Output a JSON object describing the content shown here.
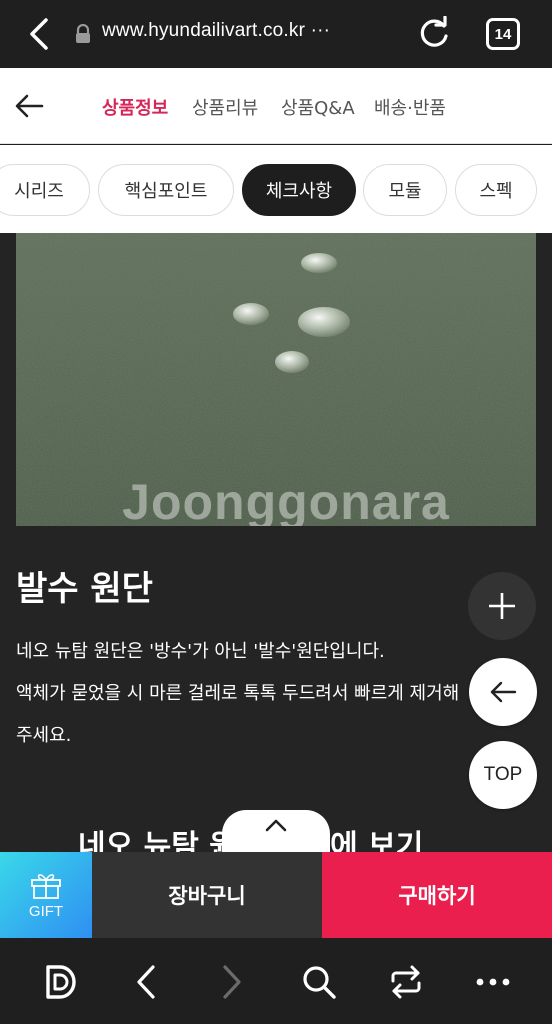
{
  "browser": {
    "url": "www.hyundailivart.co.kr",
    "url_more": "···",
    "tab_count": "14"
  },
  "product_tabs": [
    {
      "label": "상품정보",
      "active": true
    },
    {
      "label": "상품리뷰",
      "active": false
    },
    {
      "label": "상품Q&A",
      "active": false
    },
    {
      "label": "배송·반품",
      "active": false
    }
  ],
  "chips": [
    {
      "label": "시리즈",
      "active": false
    },
    {
      "label": "핵심포인트",
      "active": false
    },
    {
      "label": "체크사항",
      "active": true
    },
    {
      "label": "모듈",
      "active": false
    },
    {
      "label": "스펙",
      "active": false
    }
  ],
  "content": {
    "watermark": "Joonggonara",
    "section_title": "발수 원단",
    "desc_lines": [
      "네오 뉴탐 원단은 '방수'가 아닌 '발수'원단입니다.",
      "액체가 묻었을 시 마른 걸레로 톡톡 두드려서 빠르게 제거해",
      "주세요."
    ],
    "next_heading": "네오 뉴탐 원단 한눈에 보기"
  },
  "floating": {
    "top_label": "TOP"
  },
  "buy_bar": {
    "gift_label": "GIFT",
    "cart_label": "장바구니",
    "buy_label": "구매하기"
  },
  "colors": {
    "accent": "#d4285a",
    "buy": "#ea1f4d",
    "gift_start": "#3ad8ea",
    "gift_end": "#2f8ff2"
  }
}
